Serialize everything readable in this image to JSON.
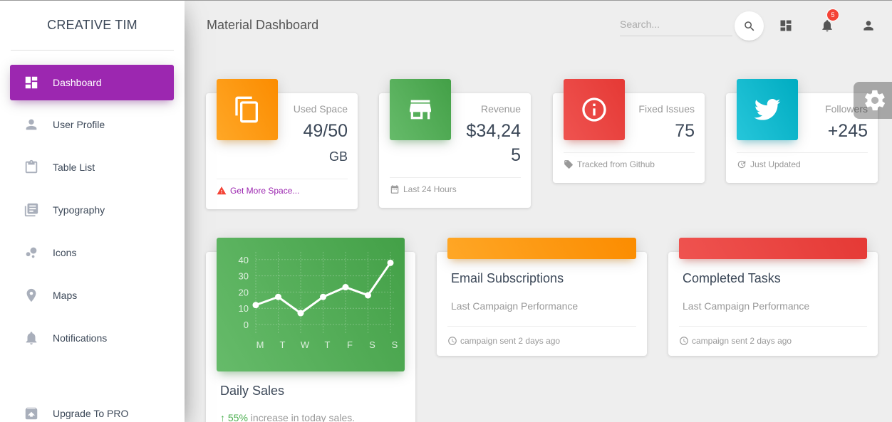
{
  "brand": "CREATIVE TIM",
  "sidebar": {
    "items": [
      {
        "label": "Dashboard",
        "icon": "dashboard-icon",
        "active": true
      },
      {
        "label": "User Profile",
        "icon": "person-icon"
      },
      {
        "label": "Table List",
        "icon": "clipboard-icon"
      },
      {
        "label": "Typography",
        "icon": "library-books-icon"
      },
      {
        "label": "Icons",
        "icon": "bubble-chart-icon"
      },
      {
        "label": "Maps",
        "icon": "location-pin-icon"
      },
      {
        "label": "Notifications",
        "icon": "bell-icon"
      }
    ],
    "upgrade": {
      "label": "Upgrade To PRO",
      "icon": "unarchive-icon"
    }
  },
  "header": {
    "title": "Material Dashboard",
    "search_placeholder": "Search...",
    "notification_count": "5"
  },
  "stats": [
    {
      "category": "Used Space",
      "value": "49/50",
      "unit": "GB",
      "footer": "Get More Space...",
      "footer_icon": "warning-icon",
      "icon": "content-copy-icon",
      "color": "#fb8c00"
    },
    {
      "category": "Revenue",
      "value": "$34,245",
      "footer": "Last 24 Hours",
      "footer_icon": "date-range-icon",
      "icon": "store-icon",
      "color": "#43a047"
    },
    {
      "category": "Fixed Issues",
      "value": "75",
      "footer": "Tracked from Github",
      "footer_icon": "local-offer-icon",
      "icon": "info-icon",
      "color": "#e53935"
    },
    {
      "category": "Followers",
      "value": "+245",
      "footer": "Just Updated",
      "footer_icon": "update-icon",
      "icon": "twitter-icon",
      "color": "#00acc1"
    }
  ],
  "cards": {
    "daily_sales": {
      "title": "Daily Sales",
      "percent": "55%",
      "text": " increase in today sales."
    },
    "email": {
      "title": "Email Subscriptions",
      "category": "Last Campaign Performance",
      "footer": "campaign sent 2 days ago",
      "color": "#fb8c00"
    },
    "tasks": {
      "title": "Completed Tasks",
      "category": "Last Campaign Performance",
      "footer": "campaign sent 2 days ago",
      "color": "#e53935"
    }
  },
  "chart_data": {
    "type": "line",
    "categories": [
      "M",
      "T",
      "W",
      "T",
      "F",
      "S",
      "S"
    ],
    "values": [
      12,
      17,
      7,
      17,
      23,
      18,
      38
    ],
    "yticks": [
      "0",
      "10",
      "20",
      "30",
      "40"
    ],
    "ylim": [
      0,
      50
    ],
    "grid": true
  }
}
